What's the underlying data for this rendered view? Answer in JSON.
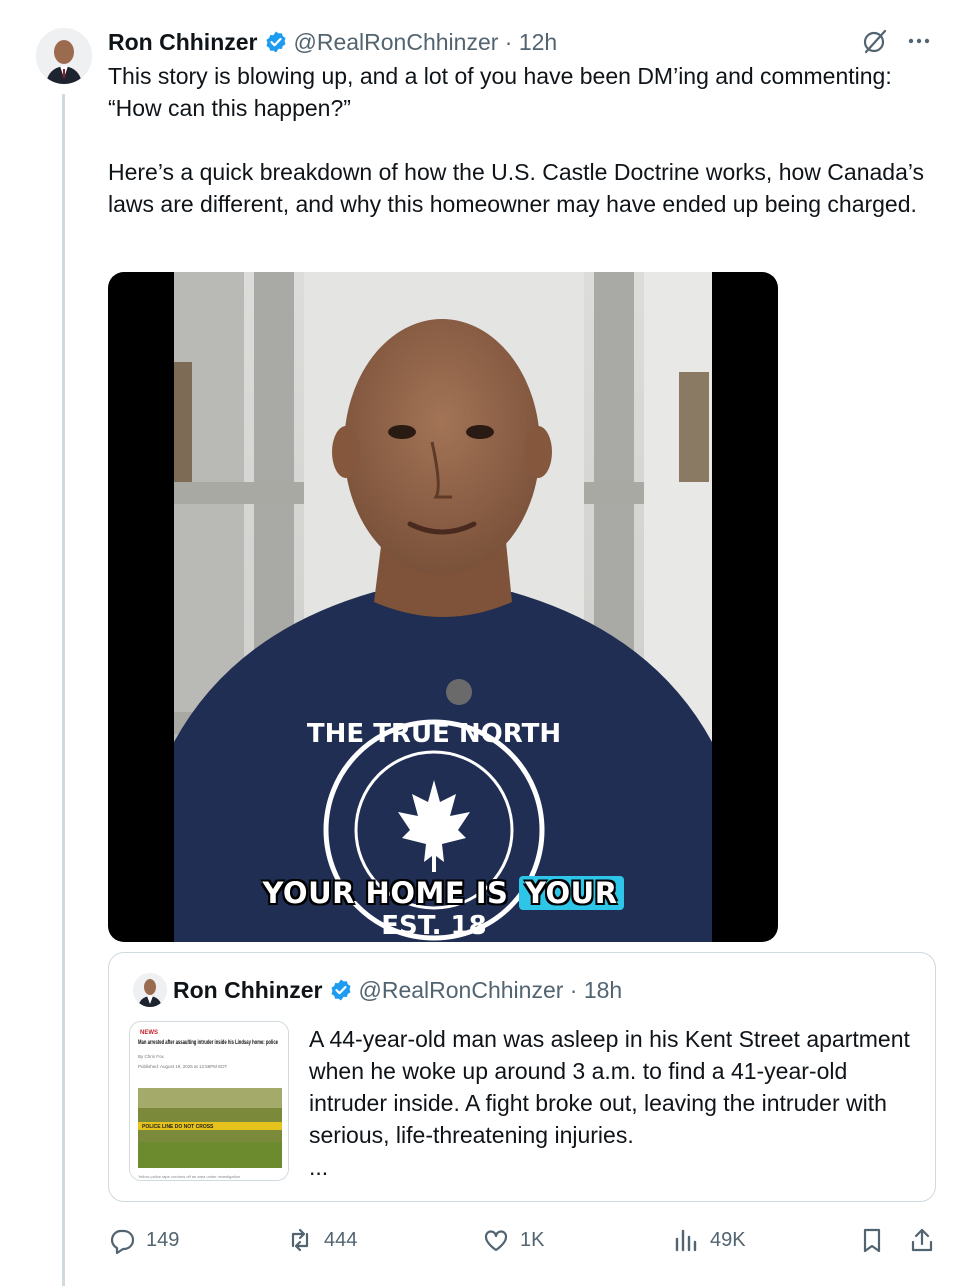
{
  "tweet": {
    "author_name": "Ron Chhinzer",
    "handle_time": "@RealRonChhinzer · 12h",
    "paragraphs": [
      "This story is blowing up, and a lot of you have been DM’ing and commenting: “How can this happen?”",
      "Here’s a quick breakdown of how the U.S. Castle Doctrine works, how Canada’s laws are different, and why this homeowner may have ended up being charged."
    ],
    "video_caption_part1": "YOUR HOME IS",
    "video_caption_part2": "YOUR",
    "shirt_text_top": "THE TRUE NORTH",
    "shirt_text_bottom": "EST. 18"
  },
  "quote": {
    "author_name": "Ron Chhinzer",
    "handle_time": "@RealRonChhinzer · 18h",
    "text": "A 44-year-old man was asleep in his Kent Street apartment when he woke up around 3 a.m. to find a 41-year-old intruder inside. A fight broke out, leaving the intruder with serious, life-threatening injuries.",
    "more": "...",
    "thumb_tag": "NEWS",
    "thumb_headline": "Man arrested after assaulting intruder inside his Lindsay home: police",
    "thumb_byline": "By Chris Fox",
    "thumb_published": "Published: August 19, 2025 at 12:56PM EDT",
    "thumb_tape": "POLICE LINE DO NOT CROSS",
    "thumb_caption": "Yellow police tape cordons off an area under investigation"
  },
  "actions": {
    "replies": "149",
    "reposts": "444",
    "likes": "1K",
    "views": "49K"
  },
  "colors": {
    "verified": "#1d9bf0",
    "muted": "#536471",
    "caption_highlight": "#2ec6e8",
    "shirt": "#1f2e52"
  },
  "icons": [
    "verified-badge-icon",
    "grok-icon",
    "more-icon",
    "reply-icon",
    "repost-icon",
    "like-icon",
    "views-icon",
    "bookmark-icon",
    "share-icon"
  ]
}
